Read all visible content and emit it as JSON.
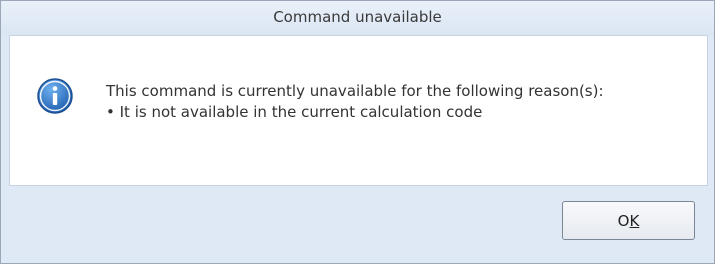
{
  "dialog": {
    "title": "Command unavailable",
    "icon": "info-icon",
    "message_line1": "This command is currently unavailable for the following reason(s):",
    "message_line2": "• It is not available in the current calculation code",
    "ok_prefix": "O",
    "ok_mnemonic": "K"
  },
  "colors": {
    "frame_bg": "#dfe9f5",
    "icon_blue": "#2f74c9",
    "button_border": "#7c8796"
  }
}
